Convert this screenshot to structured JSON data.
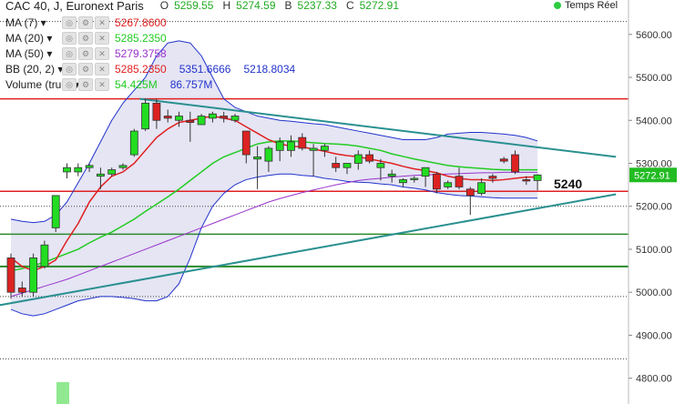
{
  "header": {
    "title": "CAC 40, J, Euronext Paris",
    "ohlc": [
      {
        "k": "O",
        "v": "5259.55"
      },
      {
        "k": "H",
        "v": "5274.59"
      },
      {
        "k": "B",
        "v": "5237.33"
      },
      {
        "k": "C",
        "v": "5272.91"
      }
    ],
    "live_label": "Temps Réel"
  },
  "indicators": [
    {
      "label": "MA (7)",
      "values": [
        "5267.8600"
      ],
      "colors": [
        "#e02020"
      ]
    },
    {
      "label": "MA (20)",
      "values": [
        "5285.2350"
      ],
      "colors": [
        "#22cc22"
      ]
    },
    {
      "label": "MA (50)",
      "values": [
        "5279.3758"
      ],
      "colors": [
        "#9933cc"
      ]
    },
    {
      "label": "BB (20, 2)",
      "values": [
        "5285.2350",
        "5351.6666",
        "5218.8034"
      ],
      "colors": [
        "#e02020",
        "#2233cc",
        "#2233cc"
      ]
    },
    {
      "label": "Volume (true)",
      "values": [
        "54.425M",
        "86.757M"
      ],
      "colors": [
        "#22cc22",
        "#2233cc"
      ]
    }
  ],
  "chart_data": {
    "type": "candlestick",
    "ylim": [
      4740,
      5680
    ],
    "y_ticks": [
      "5600.00",
      "5500.00",
      "5400.00",
      "5300.00",
      "5200.00",
      "5100.00",
      "5000.00",
      "4900.00",
      "4800.00"
    ],
    "last_price": "5272.91",
    "annotation": "5240",
    "candles": [
      [
        5080,
        5090,
        4985,
        5000
      ],
      [
        5010,
        5025,
        4990,
        5000
      ],
      [
        5000,
        5090,
        4990,
        5080
      ],
      [
        5060,
        5120,
        5055,
        5110
      ],
      [
        5150,
        5225,
        5140,
        5225
      ],
      [
        5280,
        5300,
        5265,
        5290
      ],
      [
        5280,
        5300,
        5270,
        5290
      ],
      [
        5290,
        5300,
        5280,
        5295
      ],
      [
        5270,
        5290,
        5240,
        5275
      ],
      [
        5275,
        5290,
        5270,
        5285
      ],
      [
        5290,
        5300,
        5285,
        5295
      ],
      [
        5320,
        5380,
        5315,
        5375
      ],
      [
        5380,
        5450,
        5375,
        5440
      ],
      [
        5440,
        5450,
        5380,
        5400
      ],
      [
        5410,
        5425,
        5395,
        5405
      ],
      [
        5400,
        5420,
        5385,
        5410
      ],
      [
        5400,
        5420,
        5350,
        5395
      ],
      [
        5390,
        5415,
        5390,
        5410
      ],
      [
        5405,
        5420,
        5395,
        5415
      ],
      [
        5410,
        5420,
        5395,
        5405
      ],
      [
        5400,
        5415,
        5395,
        5410
      ],
      [
        5375,
        5375,
        5300,
        5320
      ],
      [
        5310,
        5340,
        5240,
        5315
      ],
      [
        5305,
        5340,
        5280,
        5335
      ],
      [
        5330,
        5360,
        5305,
        5350
      ],
      [
        5330,
        5365,
        5315,
        5350
      ],
      [
        5360,
        5370,
        5330,
        5335
      ],
      [
        5330,
        5345,
        5270,
        5335
      ],
      [
        5330,
        5345,
        5315,
        5340
      ],
      [
        5300,
        5315,
        5280,
        5290
      ],
      [
        5290,
        5300,
        5275,
        5300
      ],
      [
        5300,
        5330,
        5285,
        5320
      ],
      [
        5320,
        5330,
        5300,
        5305
      ],
      [
        5290,
        5310,
        5260,
        5300
      ],
      [
        5270,
        5285,
        5255,
        5275
      ],
      [
        5255,
        5265,
        5245,
        5262
      ],
      [
        5265,
        5270,
        5255,
        5265
      ],
      [
        5270,
        5285,
        5245,
        5290
      ],
      [
        5275,
        5280,
        5230,
        5240
      ],
      [
        5245,
        5260,
        5240,
        5255
      ],
      [
        5270,
        5290,
        5240,
        5245
      ],
      [
        5240,
        5245,
        5180,
        5225
      ],
      [
        5230,
        5265,
        5225,
        5255
      ],
      [
        5270,
        5275,
        5255,
        5265
      ],
      [
        5310,
        5315,
        5300,
        5305
      ],
      [
        5320,
        5330,
        5275,
        5280
      ],
      [
        5262,
        5270,
        5250,
        5260
      ],
      [
        5260,
        5275,
        5237,
        5273
      ]
    ],
    "ma7": [
      5080,
      5060,
      5050,
      5060,
      5075,
      5120,
      5160,
      5210,
      5245,
      5270,
      5280,
      5300,
      5330,
      5360,
      5380,
      5395,
      5400,
      5405,
      5410,
      5405,
      5400,
      5385,
      5370,
      5355,
      5345,
      5340,
      5338,
      5333,
      5328,
      5322,
      5318,
      5315,
      5310,
      5305,
      5300,
      5293,
      5287,
      5283,
      5278,
      5270,
      5265,
      5262,
      5262,
      5260,
      5262,
      5265,
      5268,
      5268
    ],
    "ma20": [
      5050,
      5055,
      5062,
      5070,
      5080,
      5090,
      5100,
      5115,
      5128,
      5140,
      5155,
      5170,
      5188,
      5205,
      5222,
      5240,
      5260,
      5280,
      5300,
      5315,
      5325,
      5335,
      5345,
      5350,
      5352,
      5352,
      5350,
      5348,
      5346,
      5345,
      5343,
      5340,
      5335,
      5330,
      5322,
      5316,
      5310,
      5305,
      5300,
      5295,
      5292,
      5290,
      5288,
      5286,
      5285,
      5285,
      5285,
      5285
    ],
    "ma50": [
      4990,
      4998,
      5006,
      5014,
      5022,
      5030,
      5040,
      5050,
      5060,
      5070,
      5080,
      5090,
      5100,
      5110,
      5120,
      5130,
      5140,
      5150,
      5160,
      5170,
      5180,
      5190,
      5200,
      5210,
      5218,
      5225,
      5232,
      5238,
      5244,
      5250,
      5255,
      5260,
      5263,
      5265,
      5268,
      5270,
      5272,
      5273,
      5274,
      5275,
      5276,
      5277,
      5278,
      5278,
      5279,
      5279,
      5279,
      5279
    ],
    "bb_upper": [
      5170,
      5165,
      5162,
      5165,
      5180,
      5210,
      5255,
      5300,
      5350,
      5400,
      5440,
      5470,
      5500,
      5550,
      5580,
      5585,
      5580,
      5550,
      5500,
      5450,
      5430,
      5420,
      5410,
      5405,
      5400,
      5398,
      5395,
      5392,
      5390,
      5385,
      5380,
      5375,
      5370,
      5365,
      5360,
      5355,
      5355,
      5355,
      5360,
      5368,
      5370,
      5372,
      5372,
      5370,
      5368,
      5365,
      5360,
      5352
    ],
    "bb_lower": [
      4960,
      4950,
      4945,
      4950,
      4960,
      4970,
      4980,
      4985,
      4990,
      4990,
      4988,
      4985,
      4980,
      4980,
      4990,
      5020,
      5080,
      5150,
      5200,
      5230,
      5250,
      5262,
      5268,
      5272,
      5275,
      5275,
      5272,
      5270,
      5265,
      5262,
      5258,
      5256,
      5255,
      5252,
      5250,
      5245,
      5242,
      5238,
      5232,
      5228,
      5225,
      5224,
      5222,
      5220,
      5219,
      5219,
      5219,
      5219
    ],
    "volumes": [
      {
        "value": 40,
        "color": "#90e890"
      }
    ],
    "hlines": [
      {
        "y": 5630,
        "color": "#444444",
        "dashed": true
      },
      {
        "y": 5450,
        "color": "#e02020",
        "dashed": false
      },
      {
        "y": 5235,
        "color": "#e02020",
        "dashed": false
      },
      {
        "y": 5200,
        "color": "#444444",
        "dashed": true
      },
      {
        "y": 5135,
        "color": "#2a8a2a",
        "dashed": false
      },
      {
        "y": 5060,
        "color": "#2a8a2a",
        "dashed": false,
        "thick": true
      },
      {
        "y": 4990,
        "color": "#444444",
        "dashed": true
      },
      {
        "y": 4845,
        "color": "#444444",
        "dashed": true
      }
    ],
    "trendlines": [
      {
        "from": [
          11.5,
          5450
        ],
        "to": [
          54,
          5315
        ],
        "color": "#2a9090"
      },
      {
        "from": [
          -1,
          4970
        ],
        "to": [
          54,
          5228
        ],
        "color": "#2a9090"
      }
    ]
  }
}
